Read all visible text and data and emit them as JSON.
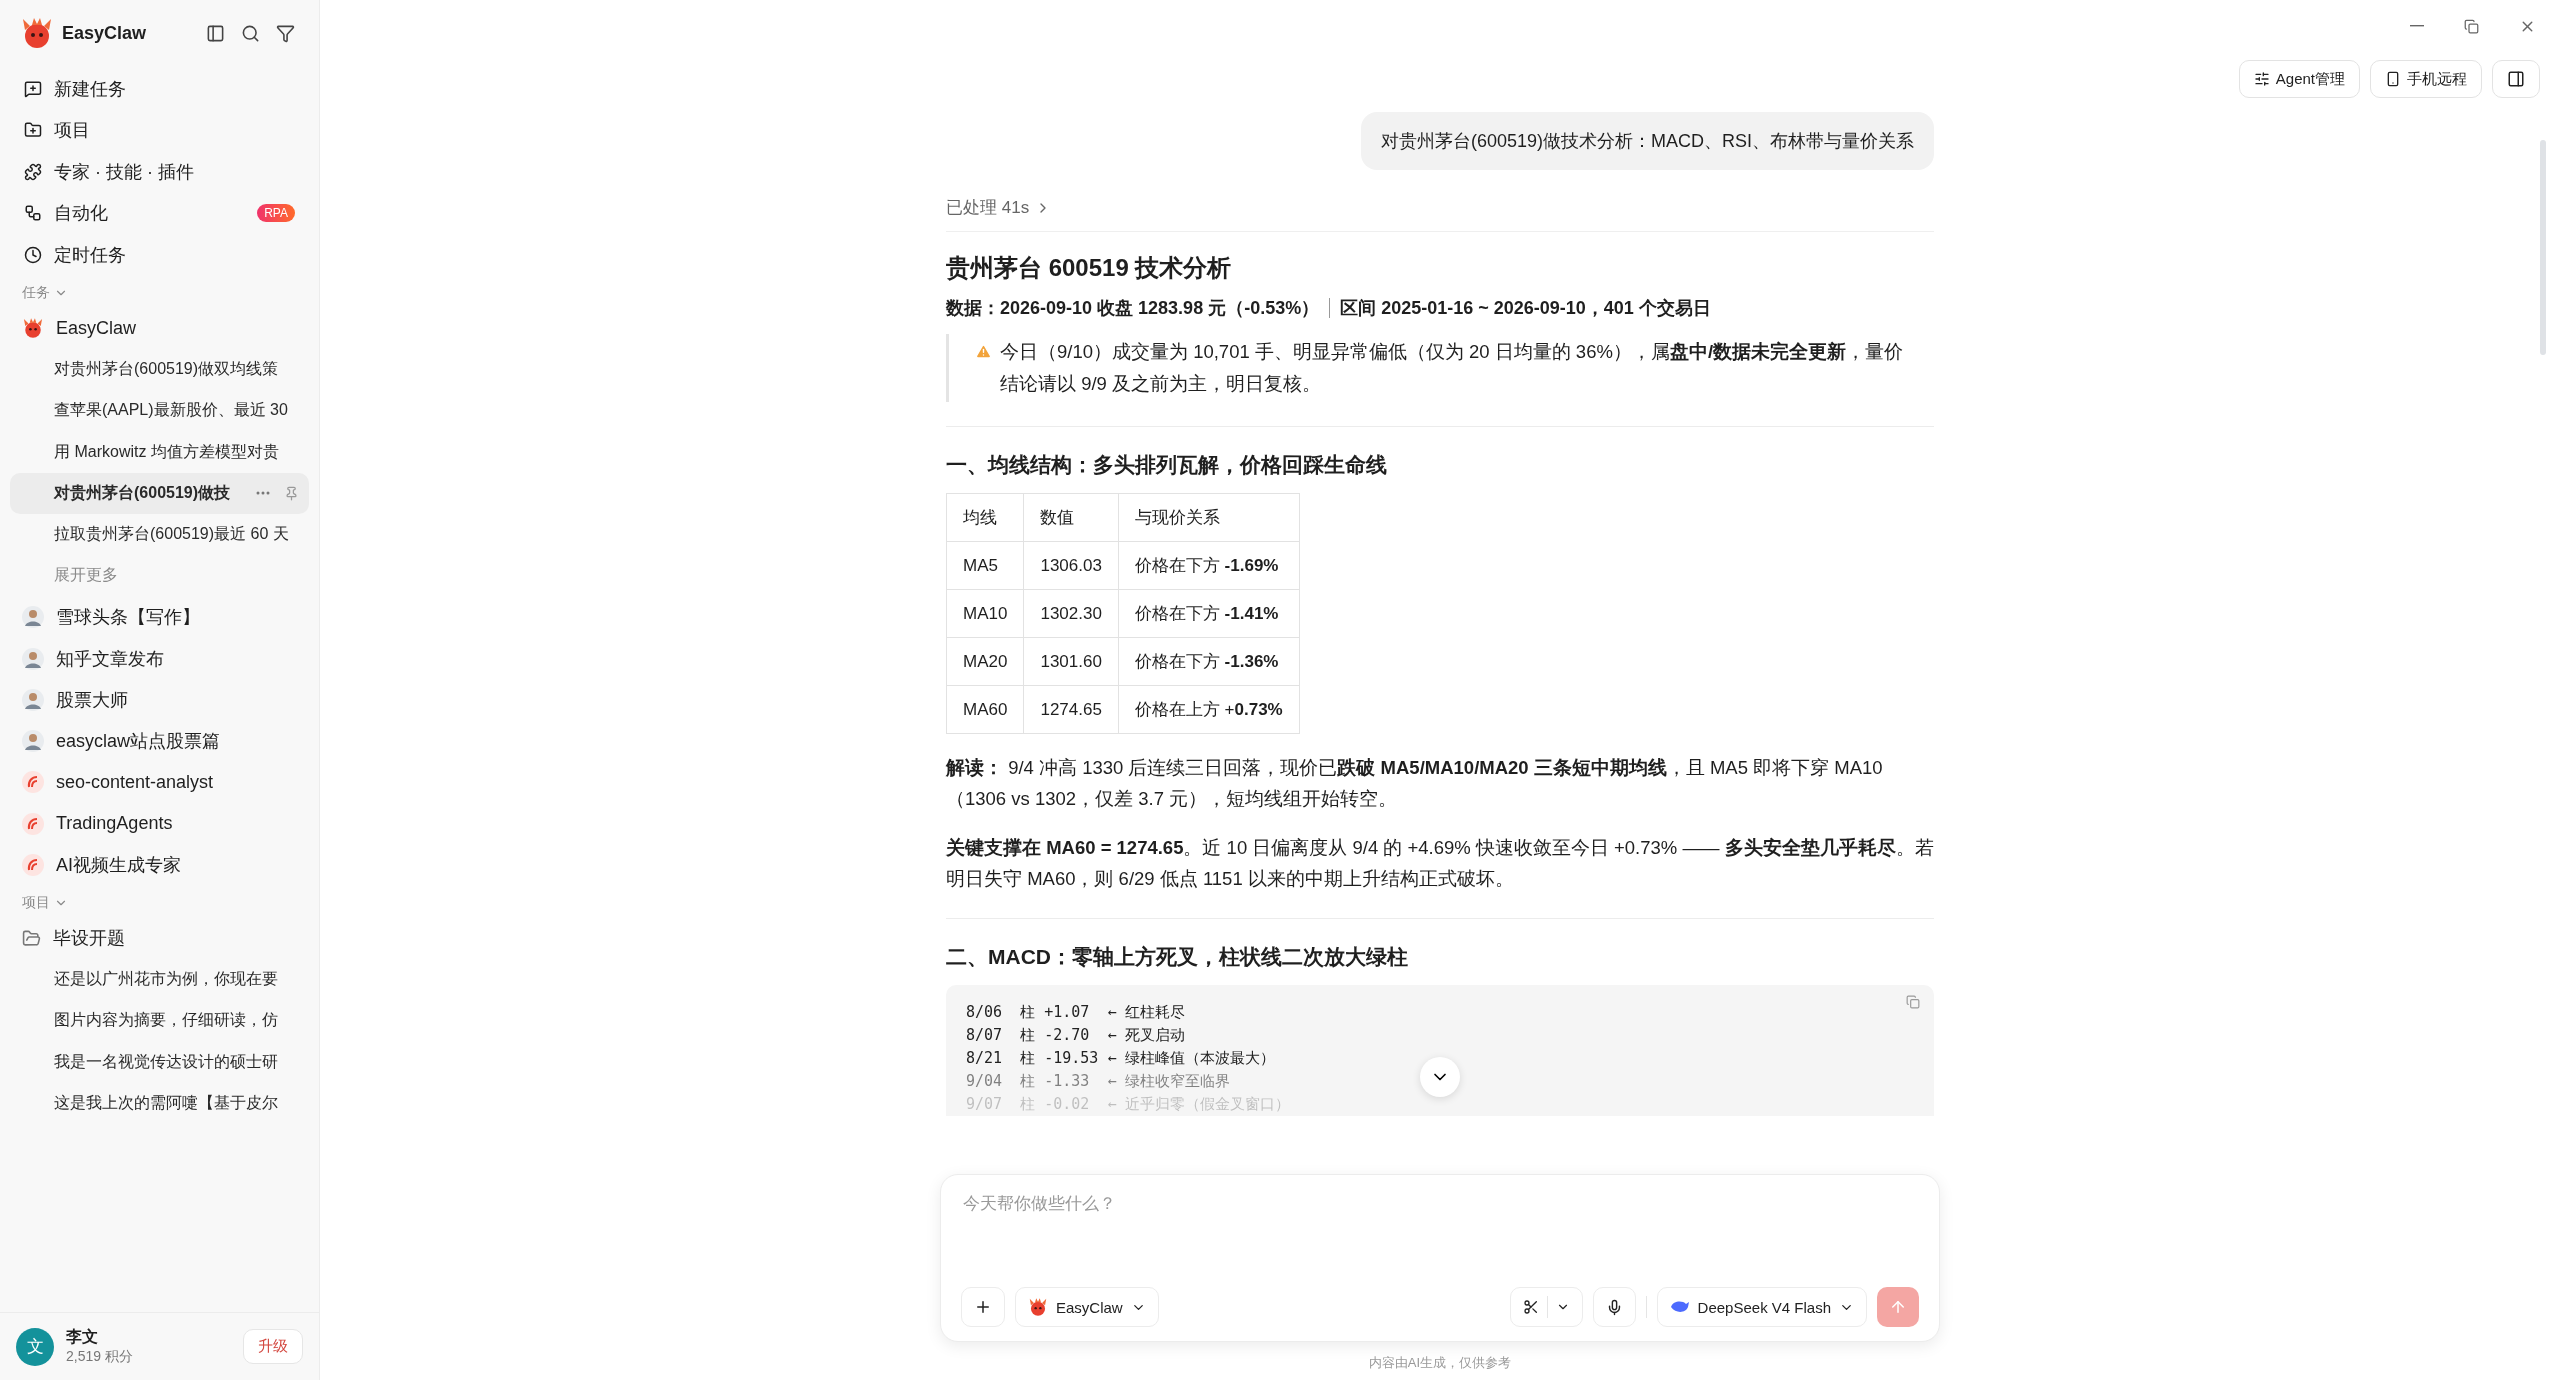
{
  "app": {
    "name": "EasyClaw"
  },
  "nav": [
    {
      "label": "新建任务"
    },
    {
      "label": "项目"
    },
    {
      "label": "专家 · 技能 · 插件"
    },
    {
      "label": "自动化",
      "badge": "RPA"
    },
    {
      "label": "定时任务"
    }
  ],
  "tasks_section": {
    "label": "任务",
    "expanded": true
  },
  "agent_group": {
    "name": "EasyClaw",
    "tasks": [
      {
        "title": "对贵州茅台(600519)做双均线策",
        "selected": false
      },
      {
        "title": "查苹果(AAPL)最新股价、最近 30",
        "selected": false
      },
      {
        "title": "用 Markowitz 均值方差模型对贵",
        "selected": false
      },
      {
        "title": "对贵州茅台(600519)做技",
        "selected": true
      },
      {
        "title": "拉取贵州茅台(600519)最近 60 天",
        "selected": false
      }
    ],
    "more": "展开更多"
  },
  "agents": [
    {
      "name": "雪球头条【写作】",
      "kind": "person"
    },
    {
      "name": "知乎文章发布",
      "kind": "person"
    },
    {
      "name": "股票大师",
      "kind": "person"
    },
    {
      "name": "easyclaw站点股票篇",
      "kind": "person"
    },
    {
      "name": "seo-content-analyst",
      "kind": "logo"
    },
    {
      "name": "TradingAgents",
      "kind": "logo"
    },
    {
      "name": "AI视频生成专家",
      "kind": "logo"
    }
  ],
  "projects_section": {
    "label": "项目",
    "expanded": true
  },
  "project": {
    "name": "毕设开题",
    "tasks": [
      "还是以广州花市为例，你现在要",
      "图片内容为摘要，仔细研读，仿",
      "我是一名视觉传达设计的硕士研",
      "这是我上次的需阿嚏【基于皮尔"
    ]
  },
  "user": {
    "name": "李文",
    "points": "2,519 积分",
    "avatar": "文",
    "upgrade": "升级"
  },
  "header_buttons": [
    "Agent管理",
    "手机远程"
  ],
  "chat": {
    "user_message": "对贵州茅台(600519)做技术分析：MACD、RSI、布林带与量价关系",
    "processed": "已处理 41s",
    "title": "贵州茅台 600519 技术分析",
    "meta": [
      "数据：2026-09-10 收盘 1283.98 元（-0.53%）",
      "区间 2025-01-16 ~ 2026-09-10，401 个交易日"
    ],
    "warning": "今日（9/10）成交量为 10,701 手、明显异常偏低（仅为 20 日均量的 36%），属**盘中/数据未完全更新**，量价结论请以 9/9 及之前为主，明日复核。",
    "sections": [
      {
        "heading": "一、均线结构：多头排列瓦解，价格回踩生命线",
        "table": {
          "columns": [
            "均线",
            "数值",
            "与现价关系"
          ],
          "rows": [
            [
              "MA5",
              "1306.03",
              "价格在下方 **-1.69%**"
            ],
            [
              "MA10",
              "1302.30",
              "价格在下方 **-1.41%**"
            ],
            [
              "MA20",
              "1301.60",
              "价格在下方 **-1.36%**"
            ],
            [
              "MA60",
              "1274.65",
              "价格在上方 +**0.73%**"
            ]
          ]
        },
        "paragraphs": [
          "**解读：** 9/4 冲高 1330 后连续三日回落，现价已**跌破 MA5/MA10/MA20 三条短中期均线**，且 MA5 即将下穿 MA10（1306 vs 1302，仅差 3.7 元），短均线组开始转空。",
          "**关键支撑在 MA60 = 1274.65**。近 10 日偏离度从 9/4 的 +4.69% 快速收敛至今日 +0.73% —— **多头安全垫几乎耗尽**。若明日失守 MA60，则 6/29 低点 1151 以来的中期上升结构正式破坏。"
        ]
      },
      {
        "heading": "二、MACD：零轴上方死叉，柱状线二次放大绿柱",
        "code": [
          "8/06  柱 +1.07  ← 红柱耗尽",
          "8/07  柱 -2.70  ← 死叉启动",
          "8/21  柱 -19.53 ← 绿柱峰值（本波最大）",
          "9/04  柱 -1.33  ← 绿柱收窄至临界",
          "9/07  柱 -0.02  ← 近乎归零（假金叉窗口）"
        ]
      }
    ]
  },
  "composer": {
    "placeholder": "今天帮你做些什么？",
    "agent": "EasyClaw",
    "model": "DeepSeek V4 Flash",
    "send_enabled": false,
    "disclaimer": "内容由AI生成，仅供参考"
  }
}
